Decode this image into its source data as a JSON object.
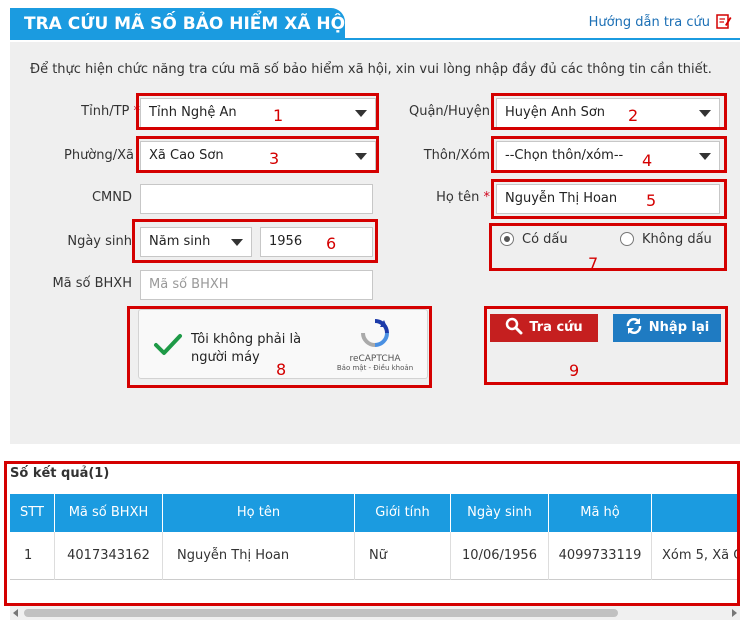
{
  "header": {
    "title": "TRA CỨU MÃ SỐ BẢO HIỂM XÃ HỘI",
    "guide_link": "Hướng dẫn tra cứu",
    "guide_icon": "edit-document-icon"
  },
  "form": {
    "intro": "Để thực hiện chức năng tra cứu mã số bảo hiểm xã hội, xin vui lòng nhập đầy đủ các thông tin cần thiết.",
    "province": {
      "label": "Tỉnh/TP",
      "required_mark": "*",
      "value": "Tỉnh Nghệ An"
    },
    "district": {
      "label": "Quận/Huyện",
      "value": "Huyện Anh Sơn"
    },
    "ward": {
      "label": "Phường/Xã",
      "value": "Xã Cao Sơn"
    },
    "hamlet": {
      "label": "Thôn/Xóm",
      "value": "--Chọn thôn/xóm--"
    },
    "id_card": {
      "label": "CMND",
      "value": ""
    },
    "full_name": {
      "label": "Họ tên",
      "required_mark": "*",
      "value": "Nguyễn Thị Hoan"
    },
    "birth": {
      "label": "Ngày sinh",
      "type_value": "Năm sinh",
      "year_value": "1956"
    },
    "accent": {
      "option_with": "Có dấu",
      "option_without": "Không dấu",
      "selected": "Có dấu"
    },
    "bhxh": {
      "label": "Mã số BHXH",
      "placeholder": "Mã số BHXH"
    },
    "captcha": {
      "text": "Tôi không phải là người máy",
      "brand": "reCAPTCHA",
      "terms": "Bảo mật - Điều khoản"
    },
    "search_button": "Tra cứu",
    "reset_button": "Nhập lại"
  },
  "annotations": [
    "1",
    "2",
    "3",
    "4",
    "5",
    "6",
    "7",
    "8",
    "9"
  ],
  "results": {
    "title": "Số kết quả(1)",
    "columns": [
      "STT",
      "Mã số BHXH",
      "Họ tên",
      "Giới tính",
      "Ngày sinh",
      "Mã hộ",
      ""
    ],
    "rows": [
      [
        "1",
        "4017343162",
        "Nguyễn Thị Hoan",
        "Nữ",
        "10/06/1956",
        "4099733119",
        "Xóm 5, Xã C"
      ]
    ]
  },
  "colors": {
    "primary": "#1b9be0",
    "search_button": "#c51f1f",
    "reset_button": "#1f7bc2",
    "annotation": "#d40000"
  }
}
